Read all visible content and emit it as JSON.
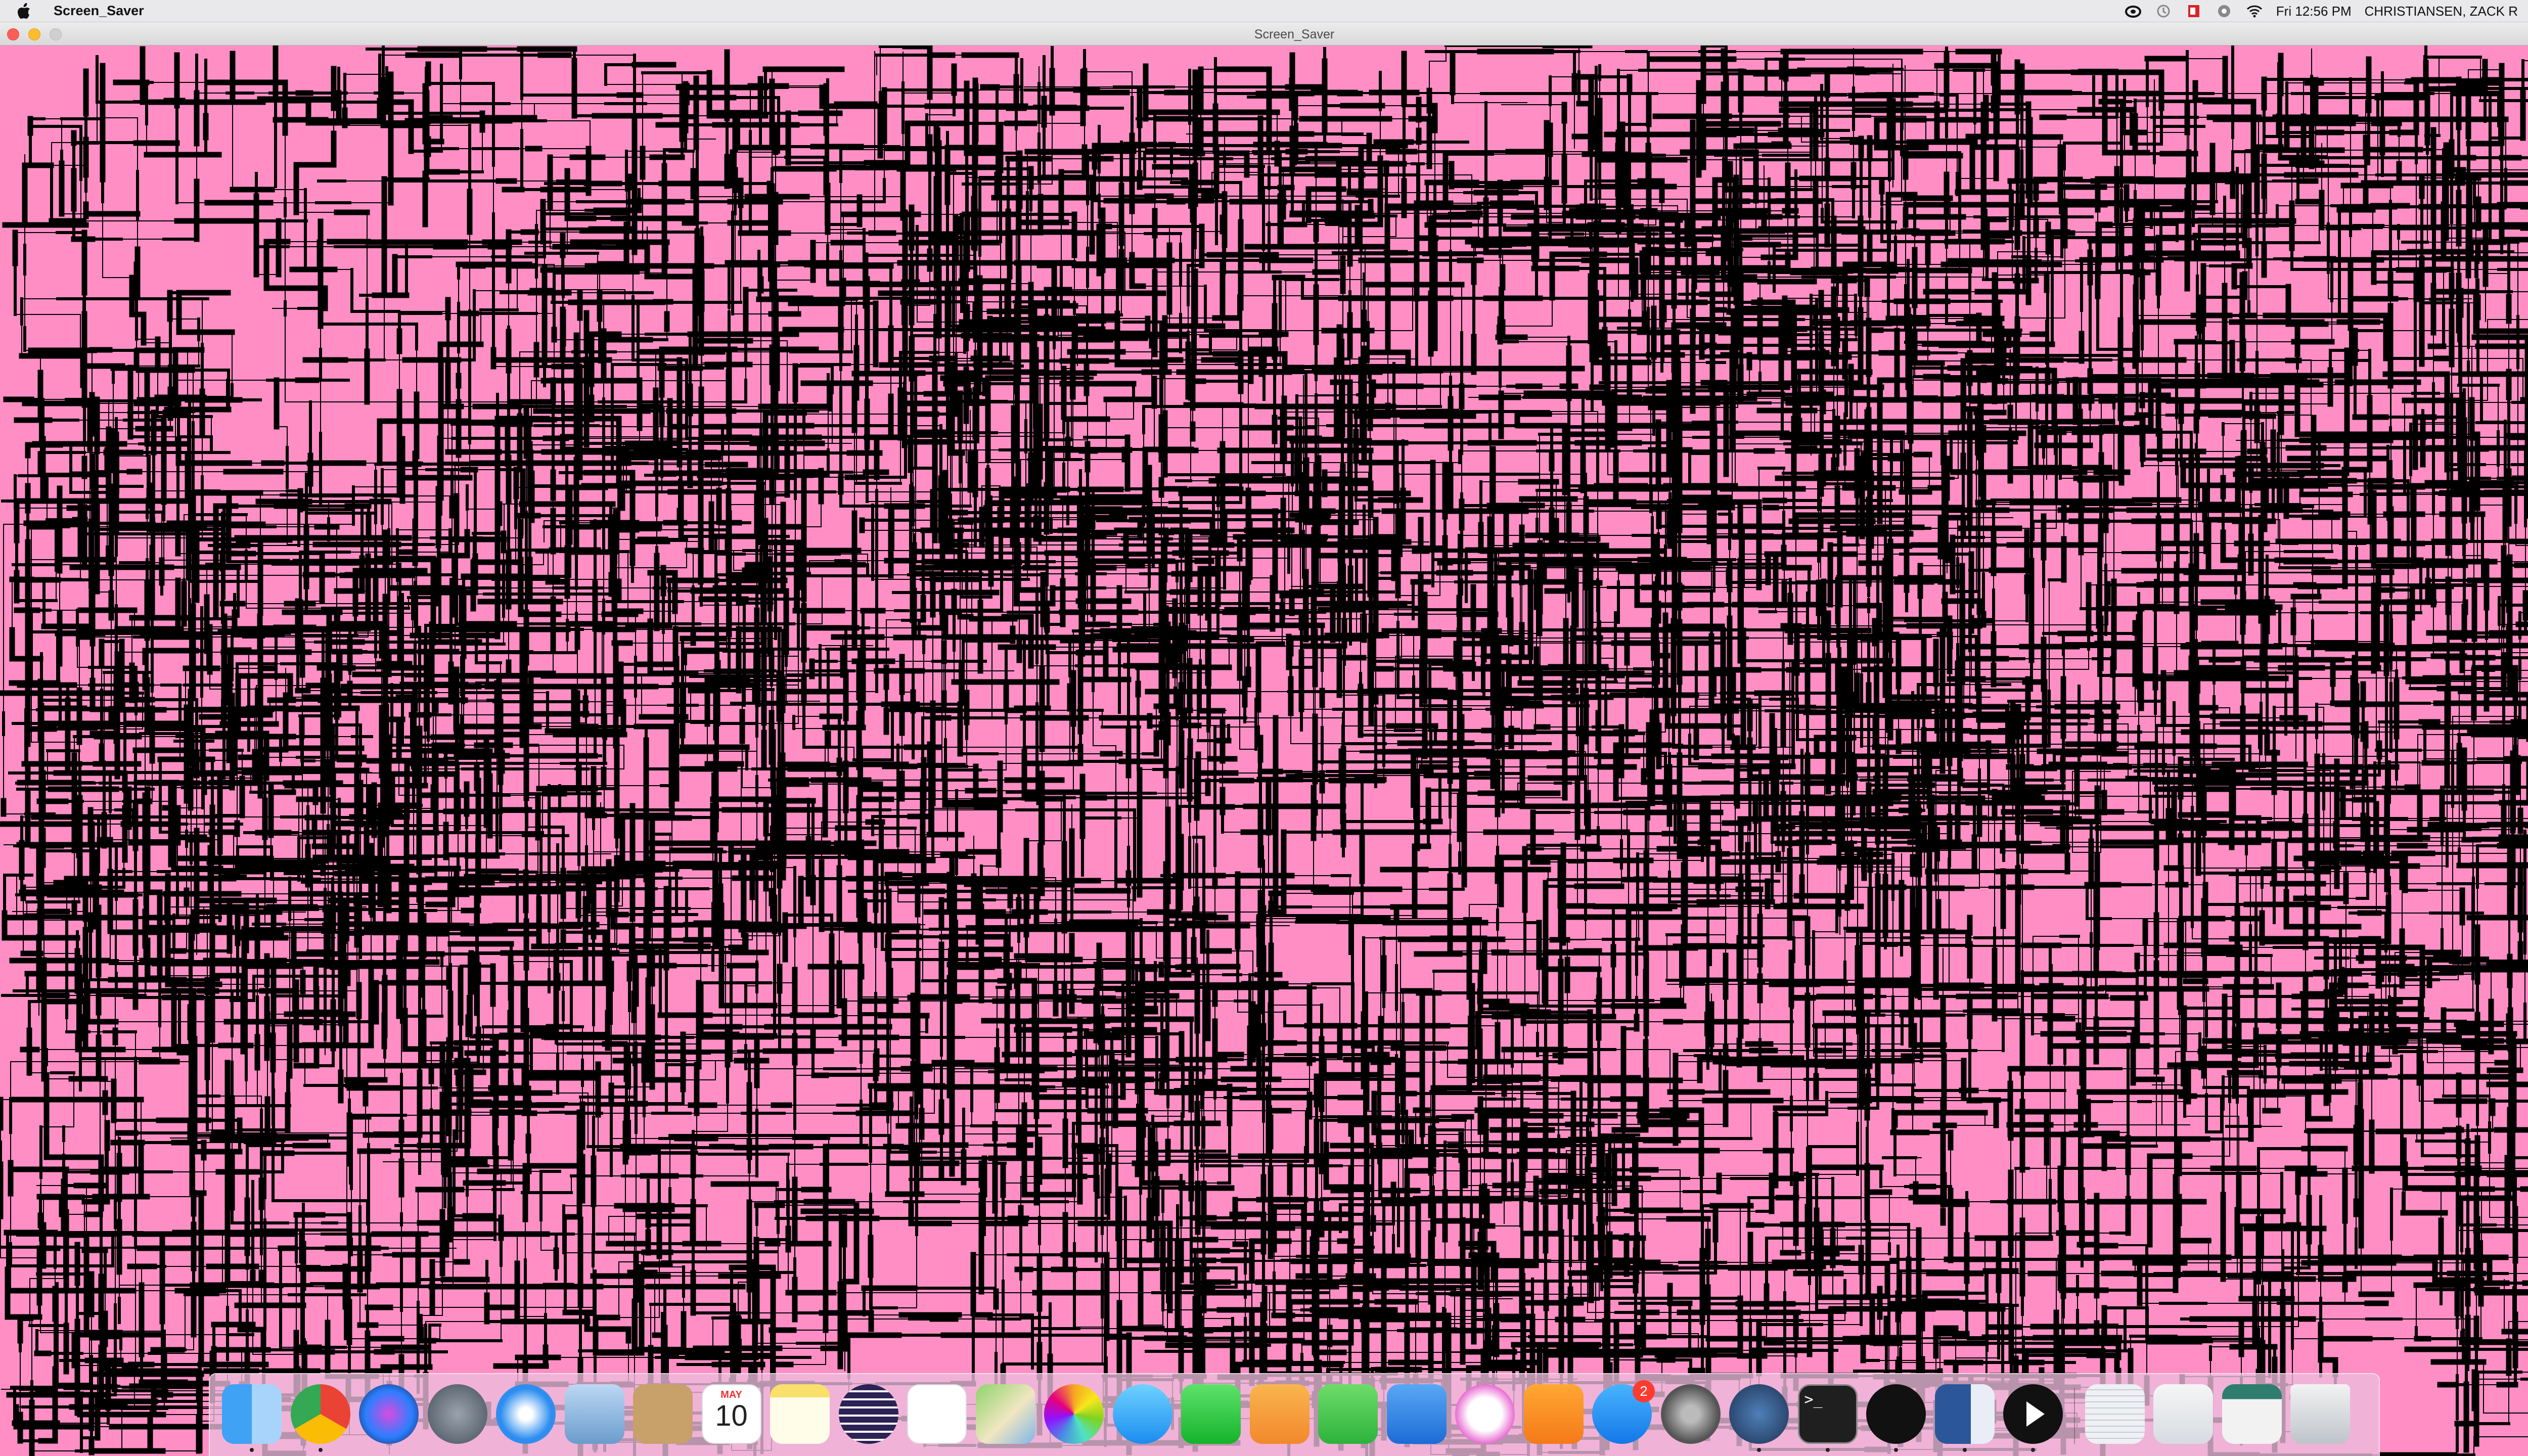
{
  "menubar": {
    "app_name": "Screen_Saver",
    "clock": "Fri 12:56 PM",
    "user": "CHRISTIANSEN, ZACK R",
    "icons": [
      "creative-cloud-icon",
      "time-machine-icon",
      "adobe-acrobat-icon",
      "chrome-sync-icon",
      "wifi-icon",
      "spotlight-search-icon",
      "notification-center-icon"
    ]
  },
  "window": {
    "title": "Screen_Saver"
  },
  "canvas": {
    "background": "#ff8ec4",
    "stroke": "#000000"
  },
  "dock": {
    "apps": [
      {
        "name": "Finder",
        "icon": "finder-icon",
        "running": true
      },
      {
        "name": "Google Chrome",
        "icon": "chrome-icon",
        "running": true
      },
      {
        "name": "Siri",
        "icon": "siri-icon",
        "running": false
      },
      {
        "name": "Launchpad",
        "icon": "launchpad-icon",
        "running": false
      },
      {
        "name": "Safari",
        "icon": "safari-icon",
        "running": false
      },
      {
        "name": "Mail",
        "icon": "mail-icon",
        "running": false
      },
      {
        "name": "Contacts",
        "icon": "contacts-icon",
        "running": false
      },
      {
        "name": "Calendar",
        "icon": "calendar-icon",
        "running": false,
        "month": "MAY",
        "day": "10"
      },
      {
        "name": "Notes",
        "icon": "notes-icon",
        "running": false
      },
      {
        "name": "Eclipse",
        "icon": "eclipse-icon",
        "running": false
      },
      {
        "name": "Reminders",
        "icon": "reminders-icon",
        "running": false
      },
      {
        "name": "Maps",
        "icon": "maps-icon",
        "running": false
      },
      {
        "name": "Photos",
        "icon": "photos-icon",
        "running": false
      },
      {
        "name": "Messages",
        "icon": "messages-icon",
        "running": false
      },
      {
        "name": "FaceTime",
        "icon": "facetime-icon",
        "running": false
      },
      {
        "name": "Pages",
        "icon": "pages-icon",
        "running": false
      },
      {
        "name": "Numbers",
        "icon": "numbers-icon",
        "running": false
      },
      {
        "name": "Keynote",
        "icon": "keynote-icon",
        "running": false
      },
      {
        "name": "iTunes",
        "icon": "itunes-icon",
        "running": false
      },
      {
        "name": "iBooks",
        "icon": "ibooks-icon",
        "running": false
      },
      {
        "name": "App Store",
        "icon": "app-store-icon",
        "running": false,
        "badge": "2"
      },
      {
        "name": "System Preferences",
        "icon": "system-preferences-icon",
        "running": false
      },
      {
        "name": "Processing",
        "icon": "processing-icon",
        "running": true
      },
      {
        "name": "Terminal",
        "icon": "terminal-icon",
        "running": true
      },
      {
        "name": "BBEdit",
        "icon": "bbedit-icon",
        "running": true
      },
      {
        "name": "Microsoft Word",
        "icon": "word-icon",
        "running": true
      },
      {
        "name": "Screen_Saver",
        "icon": "play-icon",
        "running": true
      }
    ],
    "stack_items": [
      {
        "name": "Documents stack",
        "icon": "documents-stack-icon"
      },
      {
        "name": "Downloads stack",
        "icon": "downloads-stack-icon"
      },
      {
        "name": "Screenshots stack",
        "icon": "screenshots-stack-icon"
      },
      {
        "name": "Trash",
        "icon": "trash-icon"
      }
    ],
    "terminal_prompt": ">_"
  }
}
